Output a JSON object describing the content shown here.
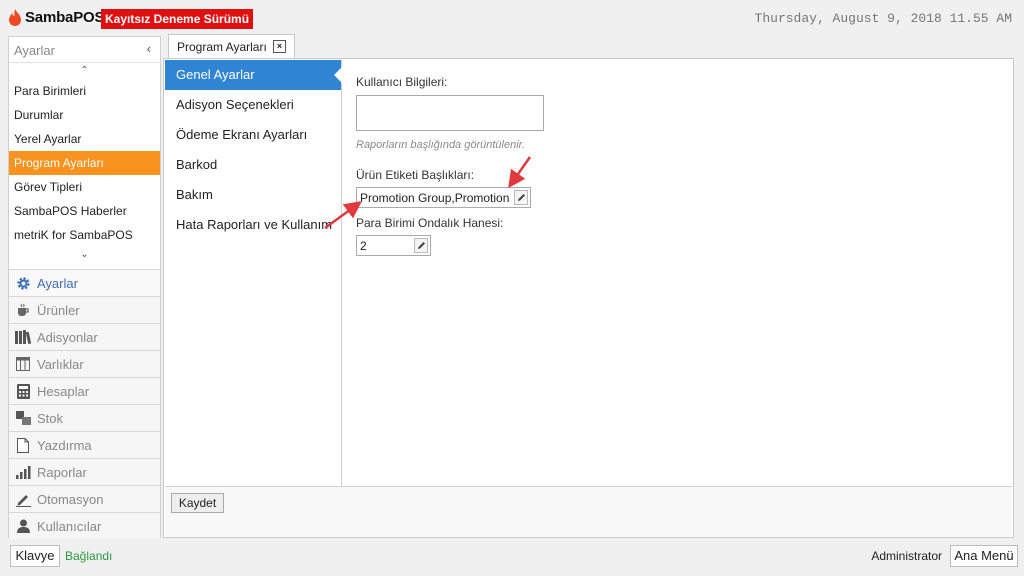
{
  "app": {
    "name": "SambaPOS",
    "trial_badge": "Kayıtsız Deneme Sürümü",
    "clock": "Thursday, August 9, 2018 11.55 AM"
  },
  "sidebar": {
    "header": "Ayarlar",
    "items": [
      {
        "label": "Para Birimleri"
      },
      {
        "label": "Durumlar"
      },
      {
        "label": "Yerel Ayarlar"
      },
      {
        "label": "Program Ayarları",
        "active": true
      },
      {
        "label": "Görev Tipleri"
      },
      {
        "label": "SambaPOS Haberler"
      },
      {
        "label": "metriK for SambaPOS"
      }
    ],
    "nav": [
      {
        "label": "Ayarlar",
        "icon": "gear-icon",
        "active": true
      },
      {
        "label": "Ürünler",
        "icon": "cup-icon"
      },
      {
        "label": "Adisyonlar",
        "icon": "books-icon"
      },
      {
        "label": "Varlıklar",
        "icon": "table-icon"
      },
      {
        "label": "Hesaplar",
        "icon": "calculator-icon"
      },
      {
        "label": "Stok",
        "icon": "stock-icon"
      },
      {
        "label": "Yazdırma",
        "icon": "document-icon"
      },
      {
        "label": "Raporlar",
        "icon": "bar-chart-icon"
      },
      {
        "label": "Otomasyon",
        "icon": "pen-icon"
      },
      {
        "label": "Kullanıcılar",
        "icon": "user-icon"
      }
    ]
  },
  "tab": {
    "label": "Program Ayarları",
    "close": "×"
  },
  "categories": [
    {
      "label": "Genel Ayarlar",
      "active": true
    },
    {
      "label": "Adisyon Seçenekleri"
    },
    {
      "label": "Ödeme Ekranı Ayarları"
    },
    {
      "label": "Barkod"
    },
    {
      "label": "Bakım"
    },
    {
      "label": "Hata Raporları ve Kullanım"
    }
  ],
  "form": {
    "user_info_label": "Kullanıcı Bilgileri:",
    "user_info_value": "",
    "user_info_hint": "Raporların başlığında görüntülenir.",
    "product_tag_label": "Ürün Etiketi Başlıkları:",
    "product_tag_value": "Promotion Group,Promotion",
    "currency_decimal_label": "Para Birimi Ondalık Hanesi:",
    "currency_decimal_value": "2",
    "save_button": "Kaydet"
  },
  "footer": {
    "keyboard_button": "Klavye",
    "connection_status": "Bağlandı",
    "user": "Administrator",
    "main_menu_button": "Ana Menü"
  },
  "colors": {
    "accent_orange": "#f7931e",
    "selection_blue": "#2f84d4",
    "badge_red": "#e01010",
    "connected_green": "#2a9a3a",
    "arrow_red": "#e0393e"
  }
}
